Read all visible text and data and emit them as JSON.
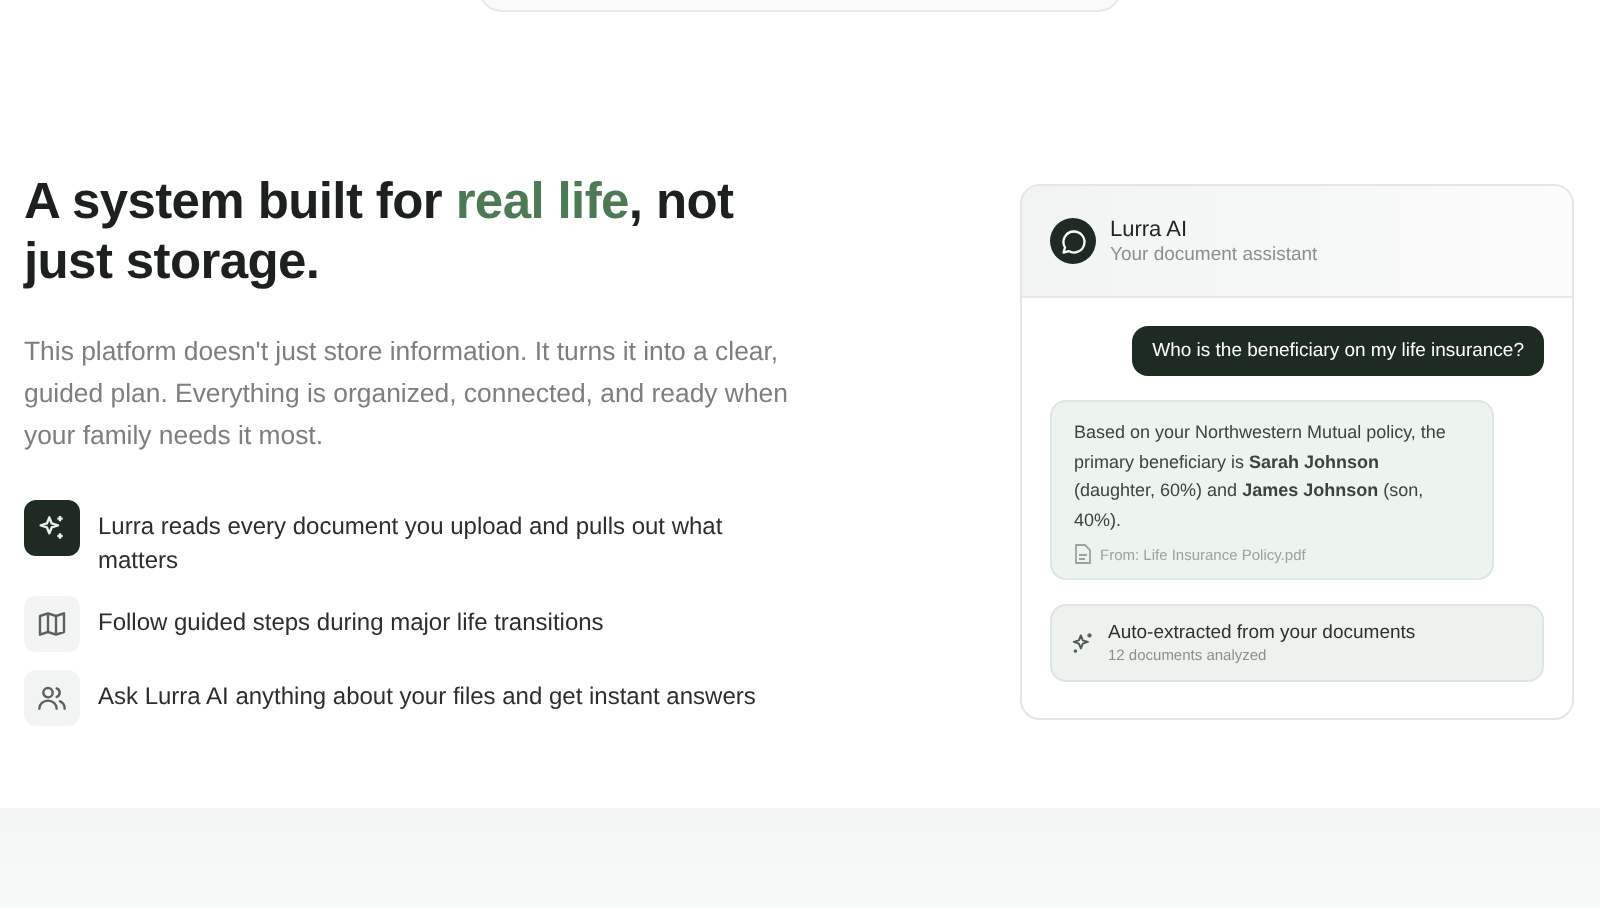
{
  "heading": {
    "before": "A system built for ",
    "highlight": "real life",
    "after": ", not just storage."
  },
  "description": "This platform doesn't just store information. It turns it into a clear, guided plan. Everything is organized, connected, and ready when your family needs it most.",
  "features": [
    {
      "kind": "sparkle",
      "highlighted": true,
      "text": "Lurra reads every document you upload and pulls out what matters"
    },
    {
      "kind": "map",
      "highlighted": false,
      "text": "Follow guided steps during major life transitions"
    },
    {
      "kind": "people",
      "highlighted": false,
      "text": "Ask Lurra AI anything about your files and get instant answers"
    }
  ],
  "assistant": {
    "name": "Lurra AI",
    "subtitle": "Your document assistant",
    "question": "Who is the beneficiary on my life insurance?",
    "answer": "Based on your Northwestern Mutual policy, the primary beneficiary is **Sarah Johnson** (daughter, 60%) and **James Johnson** (son, 40%).",
    "source": "From: Life Insurance Policy.pdf",
    "summary": {
      "title": "Auto-extracted from your documents",
      "subtitle": "12 documents analyzed"
    }
  }
}
